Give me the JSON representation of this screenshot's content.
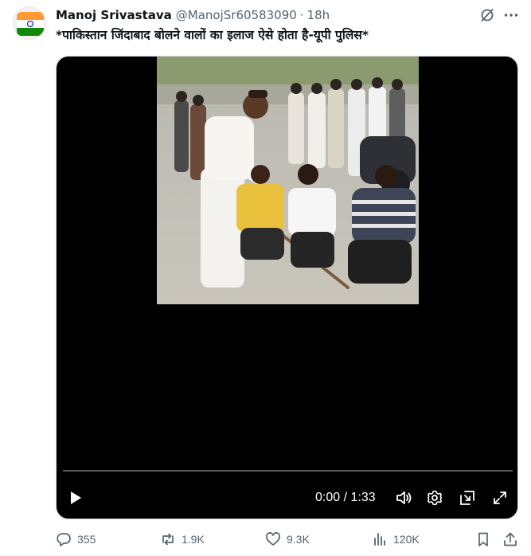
{
  "author": {
    "name": "Manoj Srivastava",
    "handle": "@ManojSr60583090",
    "separator": "·",
    "time": "18h"
  },
  "tweet": {
    "text": "*पाकिस्तान जिंदाबाद बोलने वालों का इलाज ऐसे होता है-यूपी पुलिस*"
  },
  "video": {
    "timecode": "0:00 / 1:33",
    "progress": 0
  },
  "actions": {
    "replies": "355",
    "reposts": "1.9K",
    "likes": "9.3K",
    "views": "120K"
  },
  "icons": [
    "grok-icon",
    "more-icon",
    "play-icon",
    "volume-icon",
    "settings-icon",
    "pip-icon",
    "fullscreen-icon",
    "reply-icon",
    "repost-icon",
    "like-icon",
    "views-icon",
    "bookmark-icon",
    "share-icon"
  ],
  "colors": {
    "text": "#0f1419",
    "secondary": "#536471",
    "media_bg": "#000000",
    "flag_saffron": "#ff9933",
    "flag_green": "#138808"
  }
}
